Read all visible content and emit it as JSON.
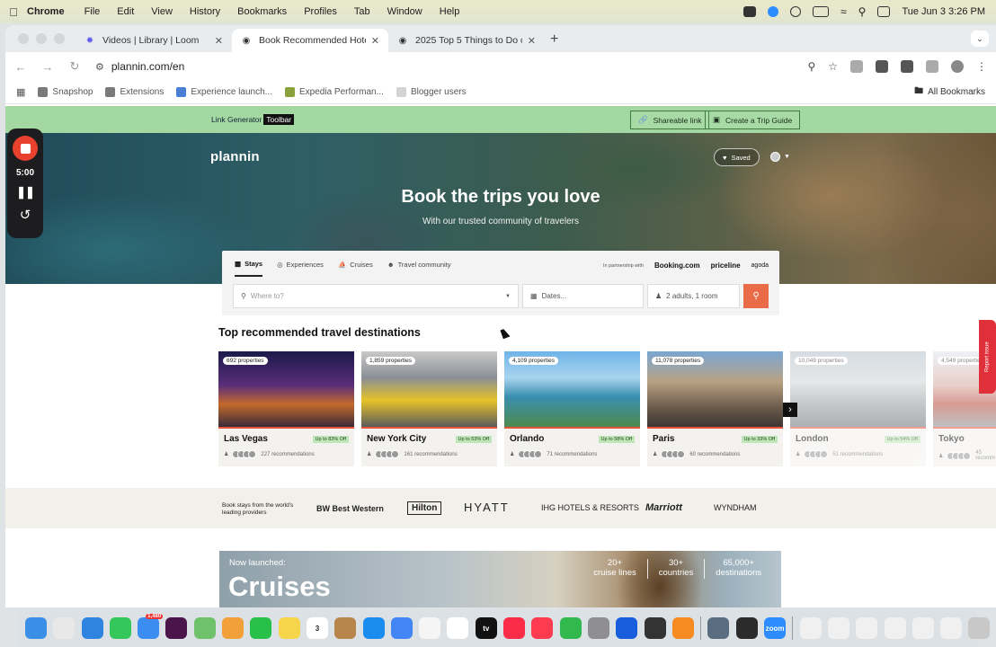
{
  "menubar": {
    "app": "Chrome",
    "items": [
      "File",
      "Edit",
      "View",
      "History",
      "Bookmarks",
      "Profiles",
      "Tab",
      "Window",
      "Help"
    ],
    "datetime": "Tue Jun 3  3:26 PM"
  },
  "tabs": [
    {
      "label": "Videos | Library | Loom",
      "active": false,
      "icon": "loom-icon",
      "color": "#625df5"
    },
    {
      "label": "Book Recommended Hotels, F",
      "active": true,
      "icon": "plannin-icon",
      "color": "#111111"
    },
    {
      "label": "2025 Top 5 Things to Do on t",
      "active": false,
      "icon": "plannin-icon",
      "color": "#111111"
    }
  ],
  "toolbar": {
    "url": "plannin.com/en"
  },
  "bookmarks": {
    "items": [
      {
        "label": "Snapshop",
        "color": "#7a7a7a"
      },
      {
        "label": "Extensions",
        "color": "#7a7a7a"
      },
      {
        "label": "Experience launch...",
        "color": "#4a7fd6"
      },
      {
        "label": "Expedia Performan...",
        "color": "#8aa23c"
      },
      {
        "label": "Blogger users",
        "color": "#d4d4d4"
      }
    ],
    "all": "All Bookmarks"
  },
  "linkgen": {
    "label": "Link Generator",
    "badge": "Toolbar",
    "share": "Shareable link",
    "guide": "Create a Trip Guide"
  },
  "recorder": {
    "time": "5:00"
  },
  "hero": {
    "logo": "plannin",
    "saved": "Saved",
    "title": "Book the trips you love",
    "subtitle": "With our trusted community of travelers"
  },
  "search": {
    "tabs": [
      "Stays",
      "Experiences",
      "Cruises",
      "Travel community"
    ],
    "partner_prefix": "In partnership with",
    "partners": [
      "Booking.com",
      "priceline",
      "agoda"
    ],
    "where_placeholder": "Where to?",
    "dates_placeholder": "Dates...",
    "guests": "2 adults, 1 room"
  },
  "destinations_title": "Top recommended travel destinations",
  "destinations": [
    {
      "name": "Las Vegas",
      "properties": "692 properties",
      "discount": "Up to 83% Off",
      "recs": "227 recommendations",
      "bg": "linear-gradient(180deg,#1b1a4a 0%,#5a2d7a 45%,#c46a2b 70%,#3a2a3a 100%)"
    },
    {
      "name": "New York City",
      "properties": "1,859 properties",
      "discount": "Up to 53% Off",
      "recs": "161 recommendations",
      "bg": "linear-gradient(180deg,#c9c9c9 0%,#8a8f96 35%,#e6c229 65%,#5b5b5b 100%)"
    },
    {
      "name": "Orlando",
      "properties": "4,109 properties",
      "discount": "Up to 58% Off",
      "recs": "71 recommendations",
      "bg": "linear-gradient(180deg,#6fb3e8 0%,#a9d4ee 35%,#3a8fb0 60%,#4c8a4e 100%)"
    },
    {
      "name": "Paris",
      "properties": "11,078 properties",
      "discount": "Up to 33% Off",
      "recs": "60 recommendations",
      "bg": "linear-gradient(180deg,#7aa6d2 0%,#b9a284 40%,#6a5a4a 75%,#3b3633 100%)"
    },
    {
      "name": "London",
      "properties": "10,049 properties",
      "discount": "Up to 54% Off",
      "recs": "51 recommendations",
      "bg": "linear-gradient(180deg,#b5c2cc 0%,#d0d4d6 40%,#8e9498 75%,#6b7278 100%)"
    },
    {
      "name": "Tokyo",
      "properties": "4,549 properties",
      "discount": "",
      "recs": "45 recomm",
      "bg": "linear-gradient(180deg,#dfe7ee 0%,#d6a9a0 45%,#b9483a 70%,#8a8f92 100%)"
    }
  ],
  "providers": {
    "label": "Book stays from the world's leading providers",
    "logos": [
      "BW Best Western",
      "Hilton",
      "HYATT",
      "IHG HOTELS & RESORTS",
      "Marriott",
      "WYNDHAM"
    ]
  },
  "cruise": {
    "launched": "Now launched:",
    "title": "Cruises",
    "stats": [
      {
        "value": "20+",
        "label": "cruise lines"
      },
      {
        "value": "30+",
        "label": "countries"
      },
      {
        "value": "65,000+",
        "label": "destinations"
      }
    ]
  },
  "report_issue": "Report issue",
  "dock": [
    {
      "name": "finder-icon",
      "color": "#3a8ee6"
    },
    {
      "name": "launchpad-icon",
      "color": "#e8e8e8"
    },
    {
      "name": "safari-icon",
      "color": "#2f84e0"
    },
    {
      "name": "messages-icon",
      "color": "#34c759"
    },
    {
      "name": "mail-icon",
      "color": "#3b8df2",
      "badge": "1,480"
    },
    {
      "name": "slack-icon",
      "color": "#4a154b"
    },
    {
      "name": "maps-icon",
      "color": "#6fc16a"
    },
    {
      "name": "photos-icon",
      "color": "#f2a03a"
    },
    {
      "name": "facetime-icon",
      "color": "#29c04a"
    },
    {
      "name": "notes-icon",
      "color": "#f7d54a"
    },
    {
      "name": "calendar-icon",
      "color": "#ffffff",
      "text": "3"
    },
    {
      "name": "brown-app-icon",
      "color": "#b8864b"
    },
    {
      "name": "appstore-icon",
      "color": "#1a8cf0"
    },
    {
      "name": "chrome-icon",
      "color": "#4285f4"
    },
    {
      "name": "reminders-icon",
      "color": "#f5f5f5"
    },
    {
      "name": "freeform-icon",
      "color": "#ffffff"
    },
    {
      "name": "tv-icon",
      "color": "#111111",
      "text": "tv"
    },
    {
      "name": "music-icon",
      "color": "#fa2d48"
    },
    {
      "name": "news-icon",
      "color": "#ff3b52"
    },
    {
      "name": "numbers-icon",
      "color": "#31b94d"
    },
    {
      "name": "settings-icon",
      "color": "#8e8e93"
    },
    {
      "name": "bitwarden-icon",
      "color": "#175ddc"
    },
    {
      "name": "toolbox-icon",
      "color": "#333333"
    },
    {
      "name": "sublime-icon",
      "color": "#f58b21"
    },
    {
      "name": "sep",
      "color": ""
    },
    {
      "name": "screen-recorder-icon",
      "color": "#5a6c80"
    },
    {
      "name": "calculator-icon",
      "color": "#2b2b2b"
    },
    {
      "name": "zoom-icon",
      "color": "#2d8cff",
      "text": "zoom"
    },
    {
      "name": "sep",
      "color": ""
    },
    {
      "name": "doc-stack-icon",
      "color": "#f0f0f0"
    },
    {
      "name": "doc-stack-icon",
      "color": "#f0f0f0"
    },
    {
      "name": "doc-stack-icon",
      "color": "#f0f0f0"
    },
    {
      "name": "doc-stack-icon",
      "color": "#f0f0f0"
    },
    {
      "name": "doc-stack-icon",
      "color": "#f0f0f0"
    },
    {
      "name": "doc-stack-icon",
      "color": "#f0f0f0"
    },
    {
      "name": "trash-icon",
      "color": "#c8c8c8"
    }
  ]
}
